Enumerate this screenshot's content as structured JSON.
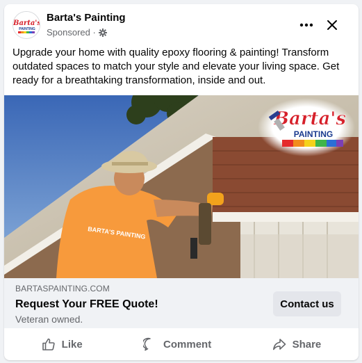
{
  "post": {
    "page_name": "Barta's Painting",
    "sponsored": "Sponsored ·",
    "caption": "Upgrade your home with quality epoxy flooring & painting! Transform outdated spaces to match your style and elevate your living space. Get ready for a breathtaking transformation, inside and out.",
    "logo": {
      "line1": "Barta's",
      "line2": "PAINTING"
    },
    "avatar_logo": {
      "line1": "Barta's",
      "line2": "PAINTING"
    },
    "shirt_text": "BARTA'S PAINTING"
  },
  "link": {
    "domain": "BARTASPAINTING.COM",
    "headline": "Request Your FREE Quote!",
    "description": "Veteran owned.",
    "cta_label": "Contact us"
  },
  "actions": {
    "like": "Like",
    "comment": "Comment",
    "share": "Share"
  },
  "icons": [
    "gear-icon",
    "more-icon",
    "close-icon",
    "like-icon",
    "comment-icon",
    "share-icon"
  ],
  "colors": {
    "brand_red": "#d6202a",
    "shirt_orange": "#f79a3c",
    "cta_bg": "#e4e6eb",
    "muted_text": "#65676b"
  }
}
